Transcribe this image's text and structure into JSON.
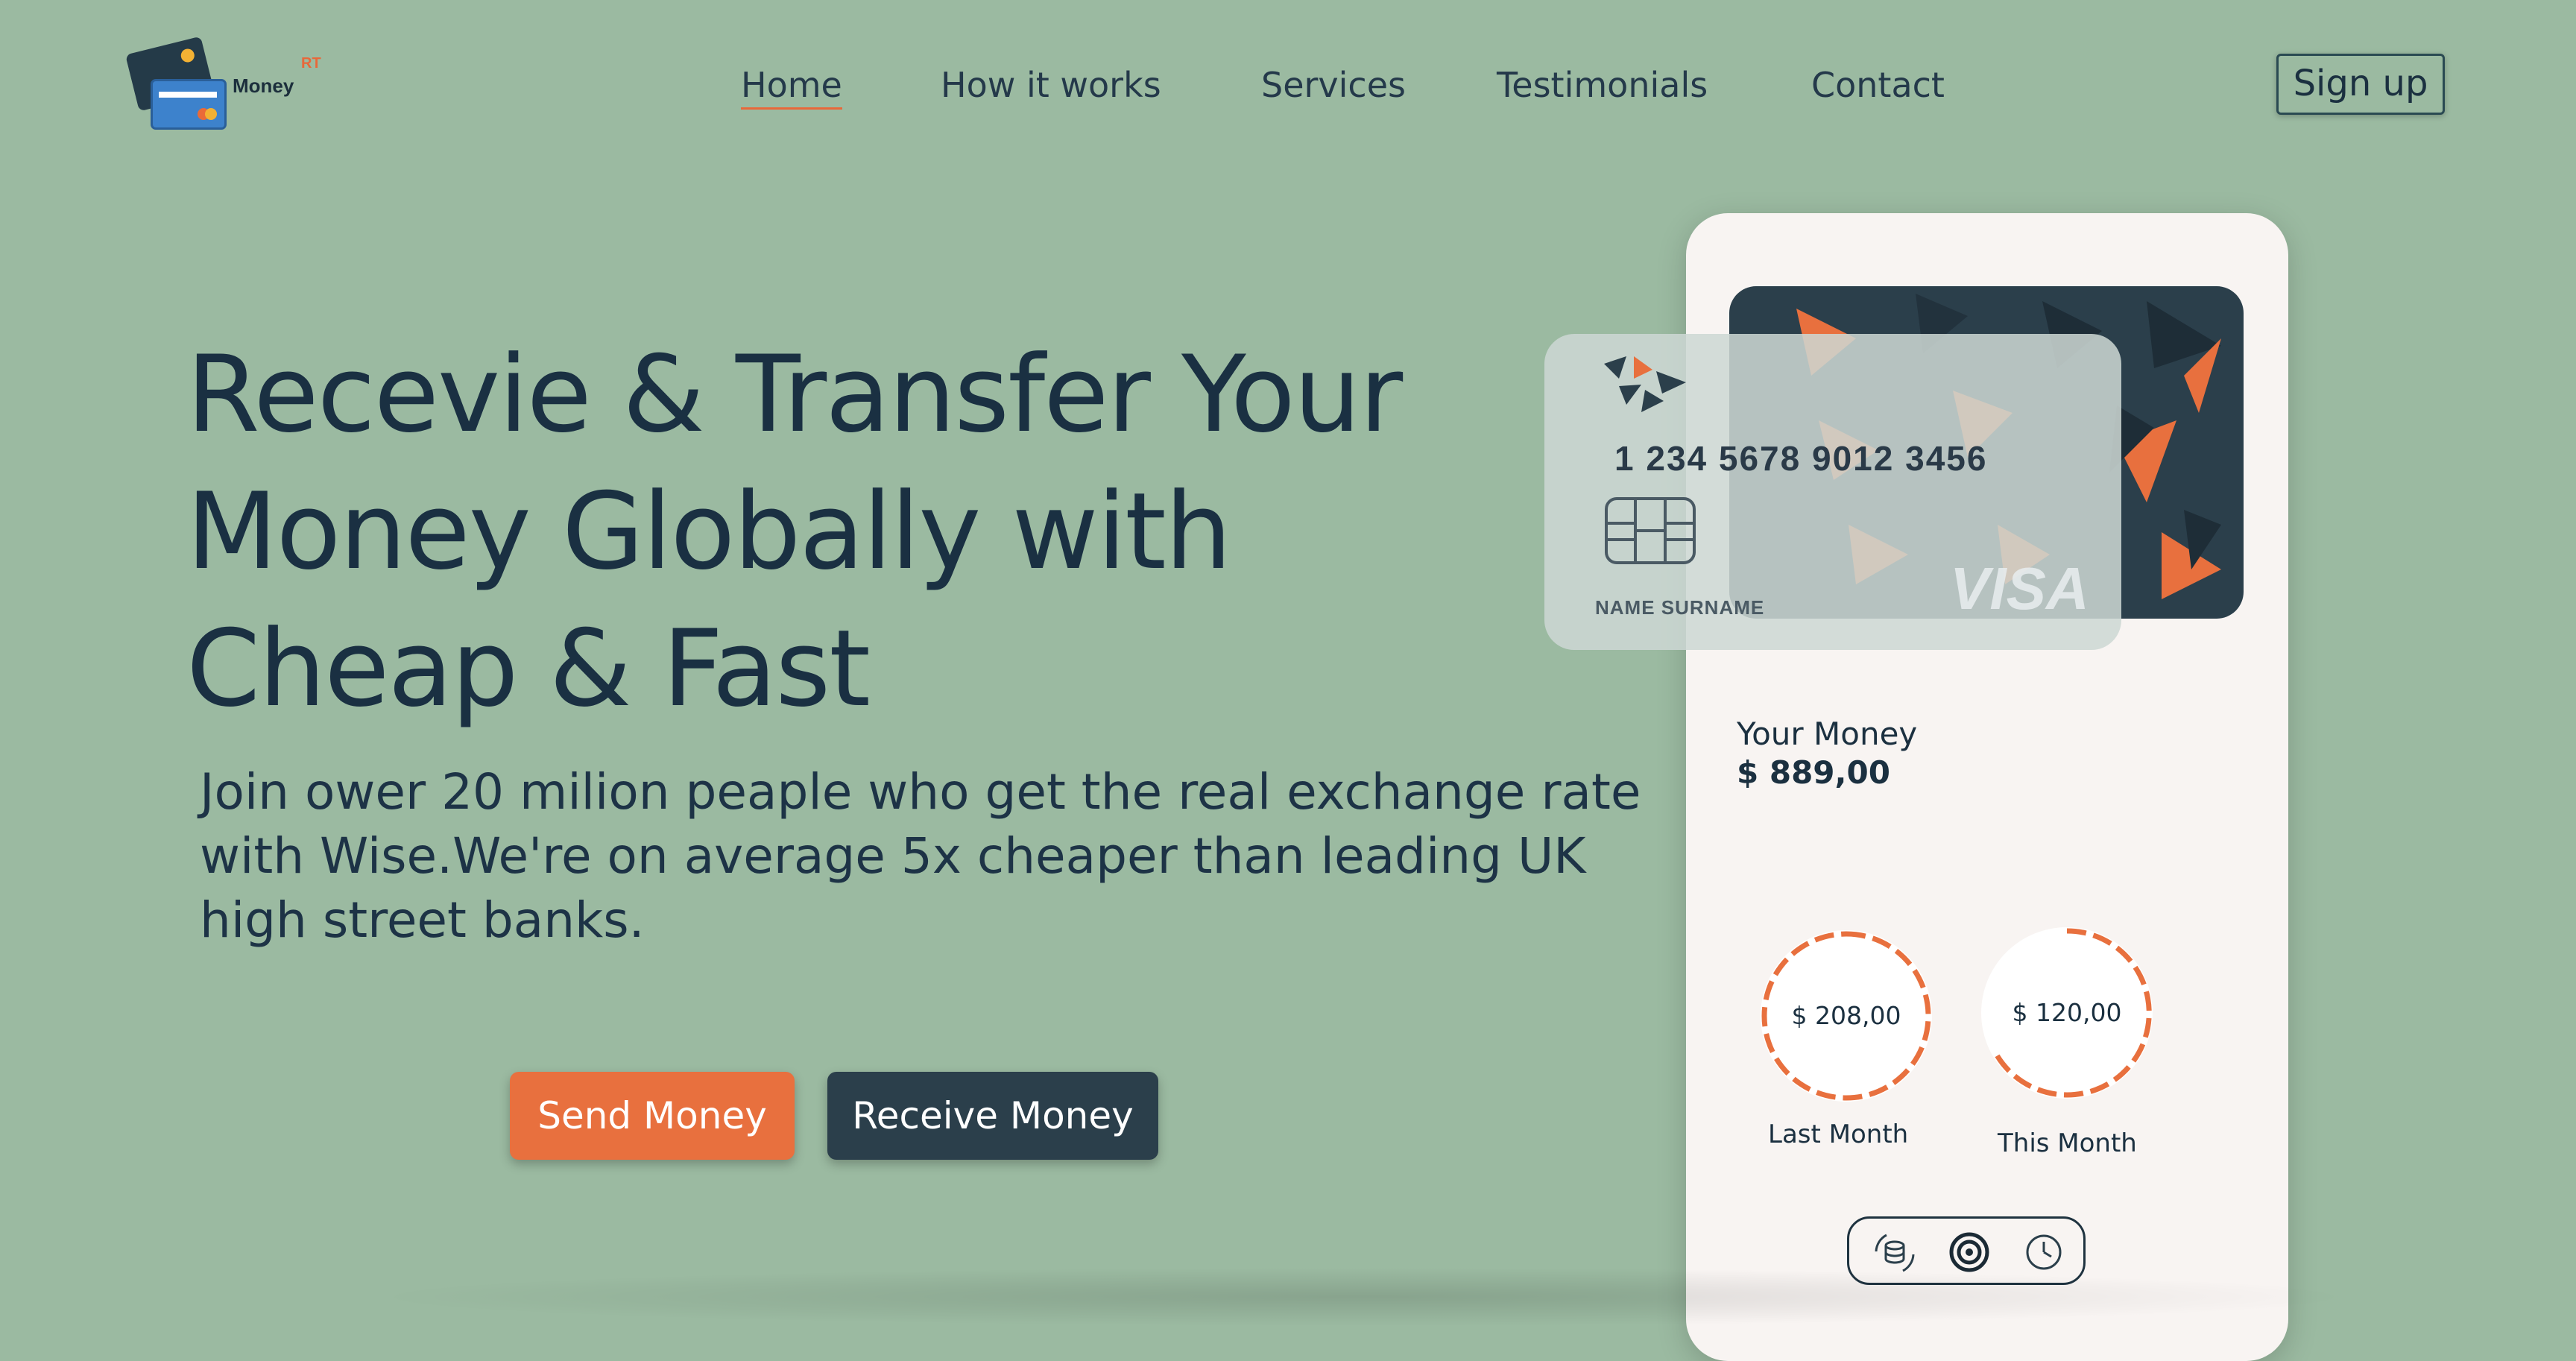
{
  "brand": {
    "name": "Money",
    "suffix": "RT"
  },
  "nav": {
    "items": [
      {
        "label": "Home",
        "active": true
      },
      {
        "label": "How it works"
      },
      {
        "label": "Services"
      },
      {
        "label": "Testimonials"
      },
      {
        "label": "Contact"
      }
    ],
    "signup_label": "Sign up"
  },
  "hero": {
    "headline": "Recevie & Transfer Your Money Globally with Cheap & Fast",
    "subtext": "Join ower 20 milion peaple who get the real exchange rate with Wise.We're on average 5x cheaper than leading UK high street banks.",
    "send_label": "Send Money",
    "receive_label": "Receive Money"
  },
  "card": {
    "number": "1 234 5678 9012 3456",
    "holder": "NAME SURNAME",
    "network": "VISA"
  },
  "wallet": {
    "title": "Your Money",
    "balance": "$ 889,00",
    "last_month": {
      "amount": "$ 208,00",
      "label": "Last Month"
    },
    "this_month": {
      "amount": "$ 120,00",
      "label": "This Month"
    },
    "tools": [
      "exchange-icon",
      "settings-icon",
      "history-icon"
    ]
  },
  "colors": {
    "background": "#9bbaa1",
    "accent": "#e8703e",
    "dark": "#2b3f4b",
    "text": "#1a3042"
  }
}
